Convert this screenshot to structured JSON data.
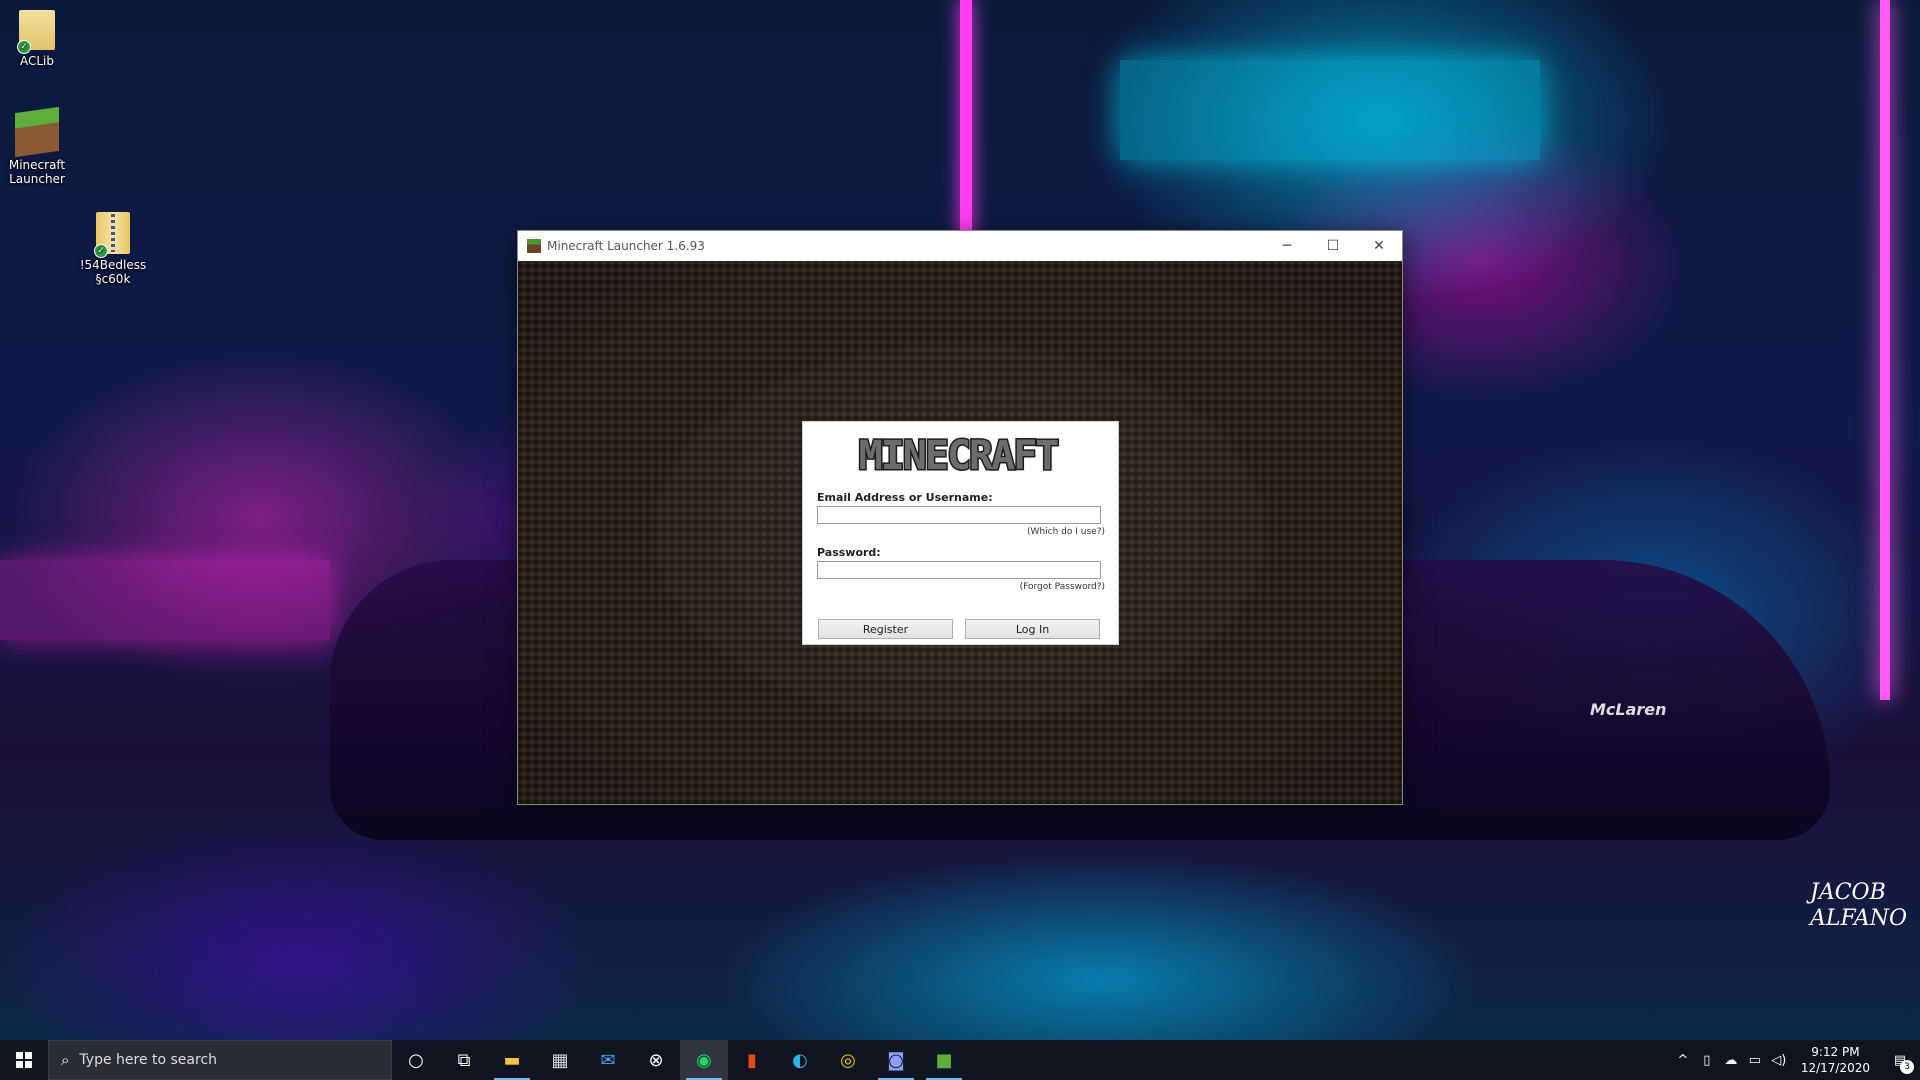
{
  "desktop": {
    "icons": [
      {
        "label": "ACLib",
        "icon": "folder-icon"
      },
      {
        "label": "Minecraft Launcher",
        "icon": "minecraft-grass-block-icon"
      },
      {
        "label": "!54Bedless §c60k",
        "icon": "zip-archive-icon"
      }
    ],
    "wallpaper_signature": "JACOB ALFANO",
    "wallpaper_plate": "McLaren"
  },
  "window": {
    "title": "Minecraft Launcher 1.6.93",
    "controls": {
      "minimize": "─",
      "maximize": "☐",
      "close": "✕"
    },
    "login": {
      "logo_text": "MINECRAFT",
      "username_label": "Email Address or Username:",
      "username_value": "",
      "username_help": "(Which do I use?)",
      "password_label": "Password:",
      "password_value": "",
      "password_help": "(Forgot Password?)",
      "register_label": "Register",
      "login_label": "Log In"
    }
  },
  "taskbar": {
    "search_placeholder": "Type here to search",
    "apps": [
      {
        "name": "cortana",
        "glyph": "○"
      },
      {
        "name": "task-view",
        "glyph": "⧉"
      },
      {
        "name": "file-explorer",
        "glyph": "▬"
      },
      {
        "name": "microsoft-store",
        "glyph": "▦"
      },
      {
        "name": "mail",
        "glyph": "✉"
      },
      {
        "name": "xbox",
        "glyph": "⊗"
      },
      {
        "name": "spotify",
        "glyph": "◉"
      },
      {
        "name": "office",
        "glyph": "▮"
      },
      {
        "name": "edge",
        "glyph": "◐"
      },
      {
        "name": "chrome",
        "glyph": "◎"
      },
      {
        "name": "discord",
        "glyph": "◙"
      },
      {
        "name": "minecraft",
        "glyph": "■"
      }
    ],
    "tray": {
      "chevron": "^",
      "time": "9:12 PM",
      "date": "12/17/2020",
      "notifications": "3"
    }
  }
}
